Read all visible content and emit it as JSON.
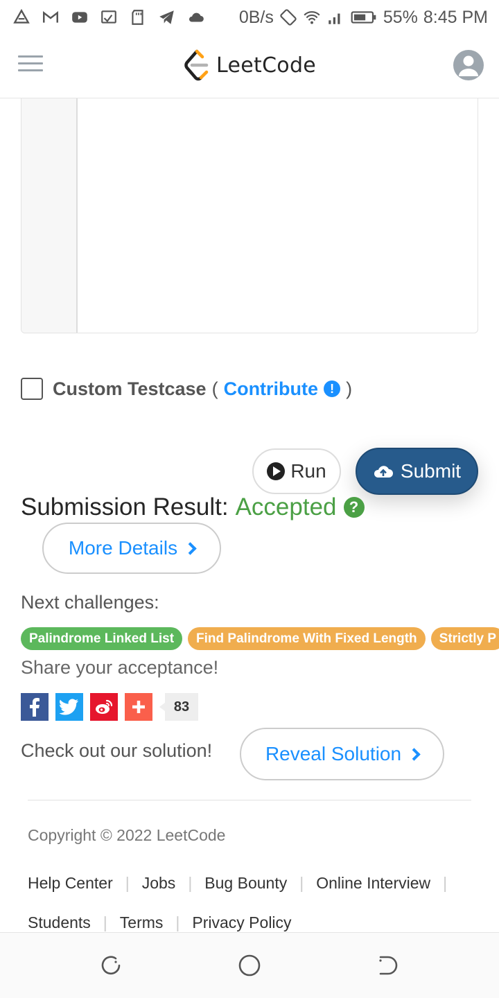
{
  "status_bar": {
    "speed": "0B/s",
    "battery": "55%",
    "time": "8:45 PM"
  },
  "navbar": {
    "logo_text": "LeetCode"
  },
  "testcase": {
    "label": "Custom Testcase",
    "paren_open": "(",
    "contribute": "Contribute",
    "paren_close": ")"
  },
  "actions": {
    "run": "Run",
    "submit": "Submit"
  },
  "result": {
    "prefix": "Submission Result:",
    "status": "Accepted",
    "more_details": "More Details"
  },
  "next": {
    "title": "Next challenges:",
    "tags": [
      {
        "label": "Palindrome Linked List",
        "color": "#5cb85c"
      },
      {
        "label": "Find Palindrome With Fixed Length",
        "color": "#f0ad4e"
      },
      {
        "label": "Strictly P",
        "color": "#f0ad4e"
      }
    ]
  },
  "share": {
    "title": "Share your acceptance!",
    "count": "83"
  },
  "solution": {
    "text": "Check out our solution!",
    "button": "Reveal Solution"
  },
  "footer": {
    "copyright": "Copyright © 2022 LeetCode",
    "links": [
      "Help Center",
      "Jobs",
      "Bug Bounty",
      "Online Interview",
      "Students",
      "Terms",
      "Privacy Policy"
    ]
  },
  "colors": {
    "accent": "#1a90ff",
    "submit": "#275b8c",
    "accepted": "#4ba045"
  }
}
